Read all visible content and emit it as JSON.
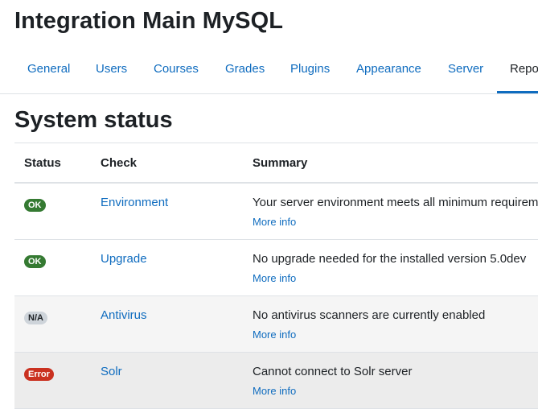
{
  "site": {
    "title": "Integration Main MySQL"
  },
  "nav": {
    "tabs": [
      {
        "label": "General"
      },
      {
        "label": "Users"
      },
      {
        "label": "Courses"
      },
      {
        "label": "Grades"
      },
      {
        "label": "Plugins"
      },
      {
        "label": "Appearance"
      },
      {
        "label": "Server"
      },
      {
        "label": "Reports"
      }
    ],
    "active_tab": "Reports"
  },
  "page": {
    "title": "System status"
  },
  "table": {
    "headers": {
      "status": "Status",
      "check": "Check",
      "summary": "Summary"
    },
    "rows": [
      {
        "status": "OK",
        "check": "Environment",
        "summary": "Your server environment meets all minimum requirements",
        "more": "More info"
      },
      {
        "status": "OK",
        "check": "Upgrade",
        "summary": "No upgrade needed for the installed version 5.0dev",
        "more": "More info"
      },
      {
        "status": "N/A",
        "check": "Antivirus",
        "summary": "No antivirus scanners are currently enabled",
        "more": "More info"
      },
      {
        "status": "Error",
        "check": "Solr",
        "summary": "Cannot connect to Solr server",
        "more": "More info"
      }
    ]
  },
  "colors": {
    "link": "#0f6cbf",
    "ok_badge": "#357a32",
    "na_badge": "#ced4da",
    "error_badge": "#ca3120"
  }
}
